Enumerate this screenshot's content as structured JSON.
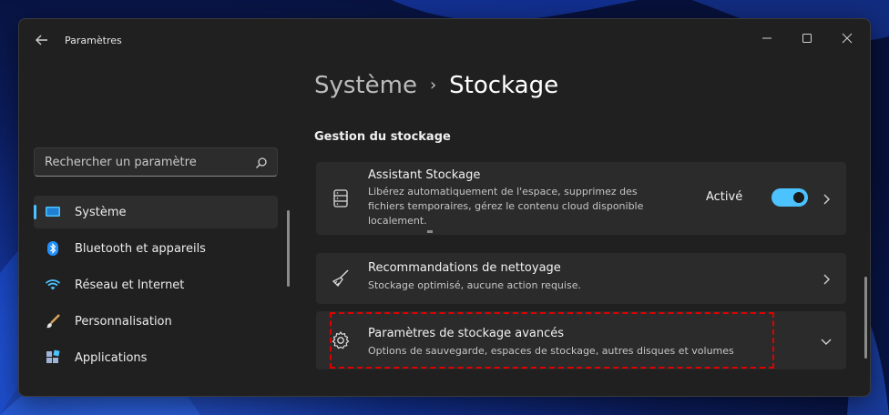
{
  "window": {
    "title": "Paramètres"
  },
  "search": {
    "placeholder": "Rechercher un paramètre"
  },
  "sidebar": {
    "items": [
      {
        "label": "Système",
        "icon": "display-icon",
        "active": true
      },
      {
        "label": "Bluetooth et appareils",
        "icon": "bluetooth-icon"
      },
      {
        "label": "Réseau et Internet",
        "icon": "wifi-icon"
      },
      {
        "label": "Personnalisation",
        "icon": "brush-icon"
      },
      {
        "label": "Applications",
        "icon": "apps-icon"
      }
    ]
  },
  "breadcrumb": {
    "parent": "Système",
    "separator": "›",
    "current": "Stockage"
  },
  "section": {
    "title": "Gestion du stockage"
  },
  "cards": [
    {
      "title": "Assistant Stockage",
      "description": [
        "Libérez automatiquement de l'espace, supprimez des",
        "fichiers temporaires, gérez le contenu cloud disponible",
        "localement."
      ],
      "status": "Activé",
      "toggle_on": true,
      "icon": "storage-drive-icon"
    },
    {
      "title": "Recommandations de nettoyage",
      "description": [
        "Stockage optimisé, aucune action requise."
      ],
      "icon": "broom-icon"
    },
    {
      "title": "Paramètres de stockage avancés",
      "description": [
        "Options de sauvegarde, espaces de stockage, autres disques et volumes"
      ],
      "icon": "gear-icon",
      "expanded": false
    }
  ],
  "colors": {
    "accent": "#4cc2ff",
    "highlight": "#e00000",
    "window_bg": "#202020",
    "card_bg": "#2b2b2b"
  }
}
